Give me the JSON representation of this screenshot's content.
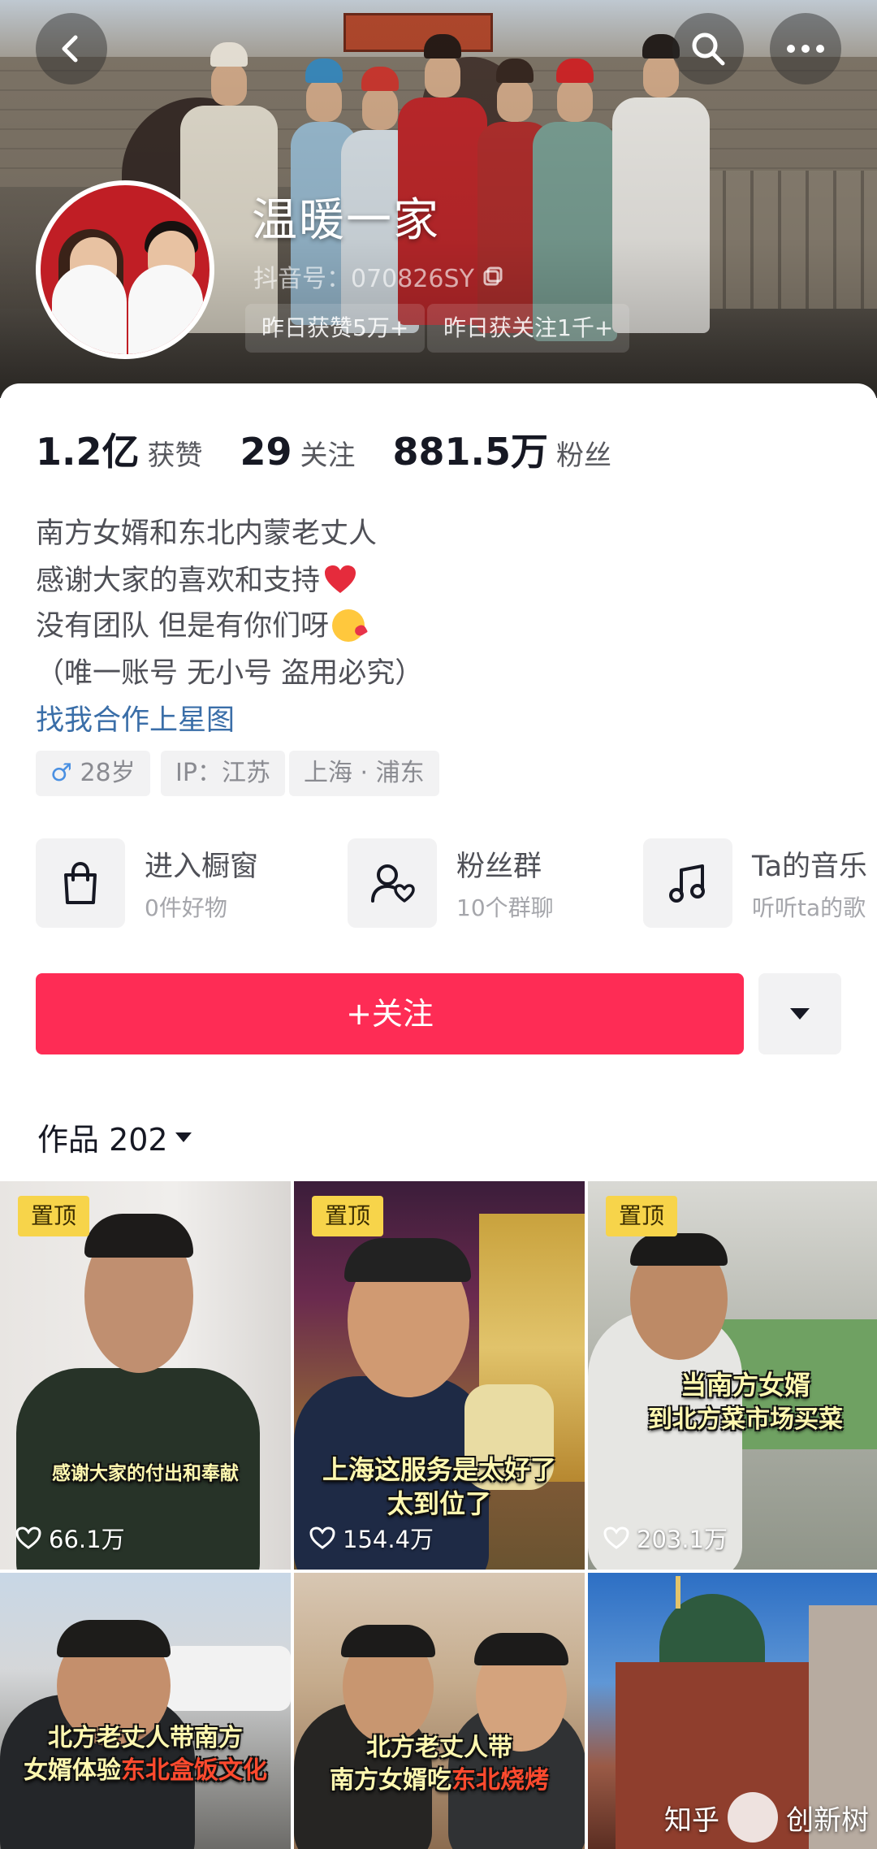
{
  "cover": {
    "nickname": "温暖一家",
    "douyin_id": "抖音号：070826SY",
    "stat_pills": [
      "昨日获赞5万+",
      "昨日获关注1千+"
    ]
  },
  "stats": [
    {
      "num": "1.2亿",
      "label": "获赞"
    },
    {
      "num": "29",
      "label": "关注"
    },
    {
      "num": "881.5万",
      "label": "粉丝"
    }
  ],
  "bio": {
    "line1": "南方女婿和东北内蒙老丈人",
    "line2": "感谢大家的喜欢和支持",
    "line3": "没有团队 但是有你们呀",
    "line4": "（唯一账号 无小号 盗用必究）",
    "link": "找我合作上星图"
  },
  "tags": {
    "gender_symbol": "♂",
    "age": "28岁",
    "ip": "IP：江苏",
    "location": "上海 · 浦东"
  },
  "services": [
    {
      "title": "进入橱窗",
      "sub": "0件好物",
      "icon": "shopping-bag-icon"
    },
    {
      "title": "粉丝群",
      "sub": "10个群聊",
      "icon": "fan-group-icon"
    },
    {
      "title": "Ta的音乐",
      "sub": "听听ta的歌",
      "icon": "music-note-icon"
    }
  ],
  "follow_label": "+关注",
  "works_label": "作品 202",
  "videos": [
    {
      "pinned": "置顶",
      "caption": "感谢大家的付出和奉献",
      "likes": "66.1万"
    },
    {
      "pinned": "置顶",
      "caption_l1": "上海这服务是太好了",
      "caption_l2": "太到位了",
      "likes": "154.4万"
    },
    {
      "pinned": "置顶",
      "caption_l1": "当南方女婿",
      "caption_l2": "到北方菜市场买菜",
      "likes": "203.1万"
    },
    {
      "caption_l1": "北方老丈人带南方",
      "caption_l2_a": "女婿体验",
      "caption_l2_b": "东北盒饭文化"
    },
    {
      "caption_l1": "北方老丈人带",
      "caption_l2_a": "南方女婿吃",
      "caption_l2_b": "东北烧烤"
    },
    {}
  ],
  "watermark": {
    "left": "知乎",
    "right": "创新树"
  },
  "colors": {
    "accent": "#fe2c55",
    "link": "#3a6ea8",
    "pin": "#f7d44a"
  }
}
